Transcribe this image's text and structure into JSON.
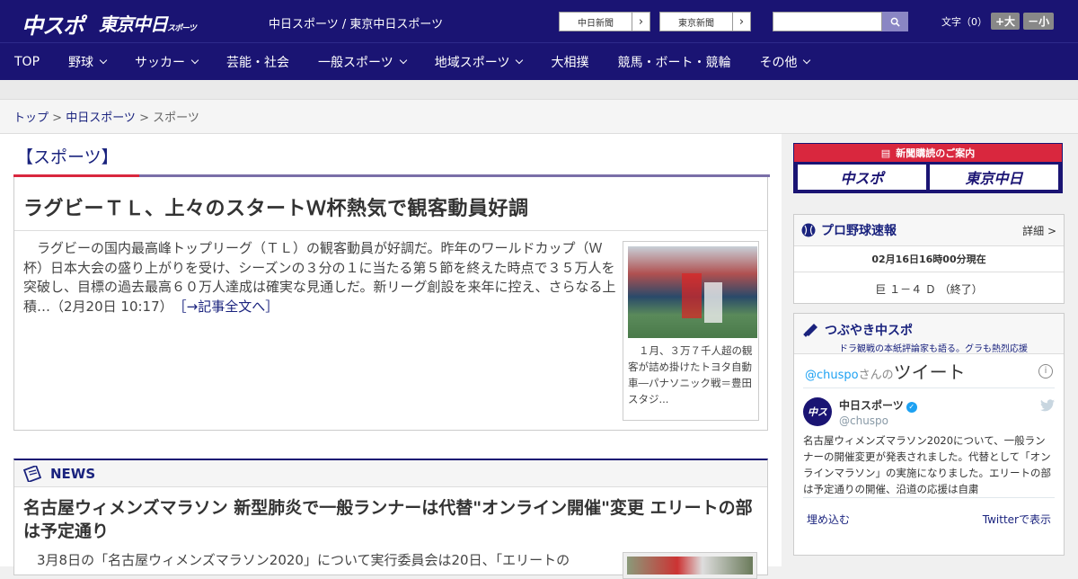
{
  "header": {
    "logo_chuspo": "中スポ",
    "logo_tokyo": "東京中日",
    "logo_tokyo_sub": "スポーツ",
    "site_names": "中日スポーツ / 東京中日スポーツ",
    "paper_link_1": "中日新聞",
    "paper_link_2": "東京新聞",
    "search_placeholder": "",
    "fontsize_label": "文字（0）",
    "font_larger": "+大",
    "font_smaller": "－小"
  },
  "nav": [
    {
      "label": "TOP",
      "dropdown": false
    },
    {
      "label": "野球",
      "dropdown": true
    },
    {
      "label": "サッカー",
      "dropdown": true
    },
    {
      "label": "芸能・社会",
      "dropdown": false
    },
    {
      "label": "一般スポーツ",
      "dropdown": true
    },
    {
      "label": "地域スポーツ",
      "dropdown": true
    },
    {
      "label": "大相撲",
      "dropdown": false
    },
    {
      "label": "競馬・ボート・競輪",
      "dropdown": false
    },
    {
      "label": "その他",
      "dropdown": true
    }
  ],
  "breadcrumb": {
    "top": "トップ",
    "sep1": " > ",
    "chunichi": "中日スポーツ",
    "sep2": " > ",
    "current": "スポーツ"
  },
  "section_title": "【スポーツ】",
  "article": {
    "headline": "ラグビーＴＬ、上々のスタートＷ杯熱気で観客動員好調",
    "body": "ラグビーの国内最高峰トップリーグ（ＴＬ）の観客動員が好調だ。昨年のワールドカップ（Ｗ杯）日本大会の盛り上がりを受け、シーズンの３分の１に当たる第５節を終えた時点で３５万人を突破し、目標の過去最高６０万人達成は確実な見通しだ。新リーグ創設を来年に控え、さらなる上積…（2月20日 10:17）",
    "more_link": "［→記事全文へ］",
    "photo_caption": "１月、３万７千人超の観客が詰め掛けたトヨタ自動車―パナソニック戦＝豊田スタジ..."
  },
  "news": {
    "label": "NEWS",
    "headline": "名古屋ウィメンズマラソン 新型肺炎で一般ランナーは代替\"オンライン開催\"変更 エリートの部は予定通り",
    "body": "3月8日の「名古屋ウィメンズマラソン2020」について実行委員会は20日、「エリートの"
  },
  "sidebar": {
    "subscription_title": "新聞購読のご案内",
    "sub_logo_1": "中スポ",
    "sub_logo_2": "東京中日",
    "baseball": {
      "title": "プロ野球速報",
      "detail": "詳細 >",
      "time": "02月16日16時00分現在",
      "score": "巨 １－４ Ｄ （終了）"
    },
    "tweet": {
      "title": "つぶやき中スポ",
      "subtitle": "ドラ観戦の本紙評論家も語る。グラも熱烈応援",
      "handle_prefix": "@chuspo",
      "handle_suffix": "さんの",
      "tweets_word": "ツイート",
      "user_name": "中日スポーツ",
      "user_handle": "@chuspo",
      "text": "名古屋ウィメンズマラソン2020について、一般ランナーの開催変更が発表されました。代替として「オンラインマラソン」の実施になりました。エリートの部は予定通りの開催、沿道の応援は自粛",
      "embed": "埋め込む",
      "view_on_twitter": "Twitterで表示"
    }
  },
  "colors": {
    "brand_navy": "#1a1473",
    "accent_red": "#d9273e",
    "link": "#1a237e"
  }
}
